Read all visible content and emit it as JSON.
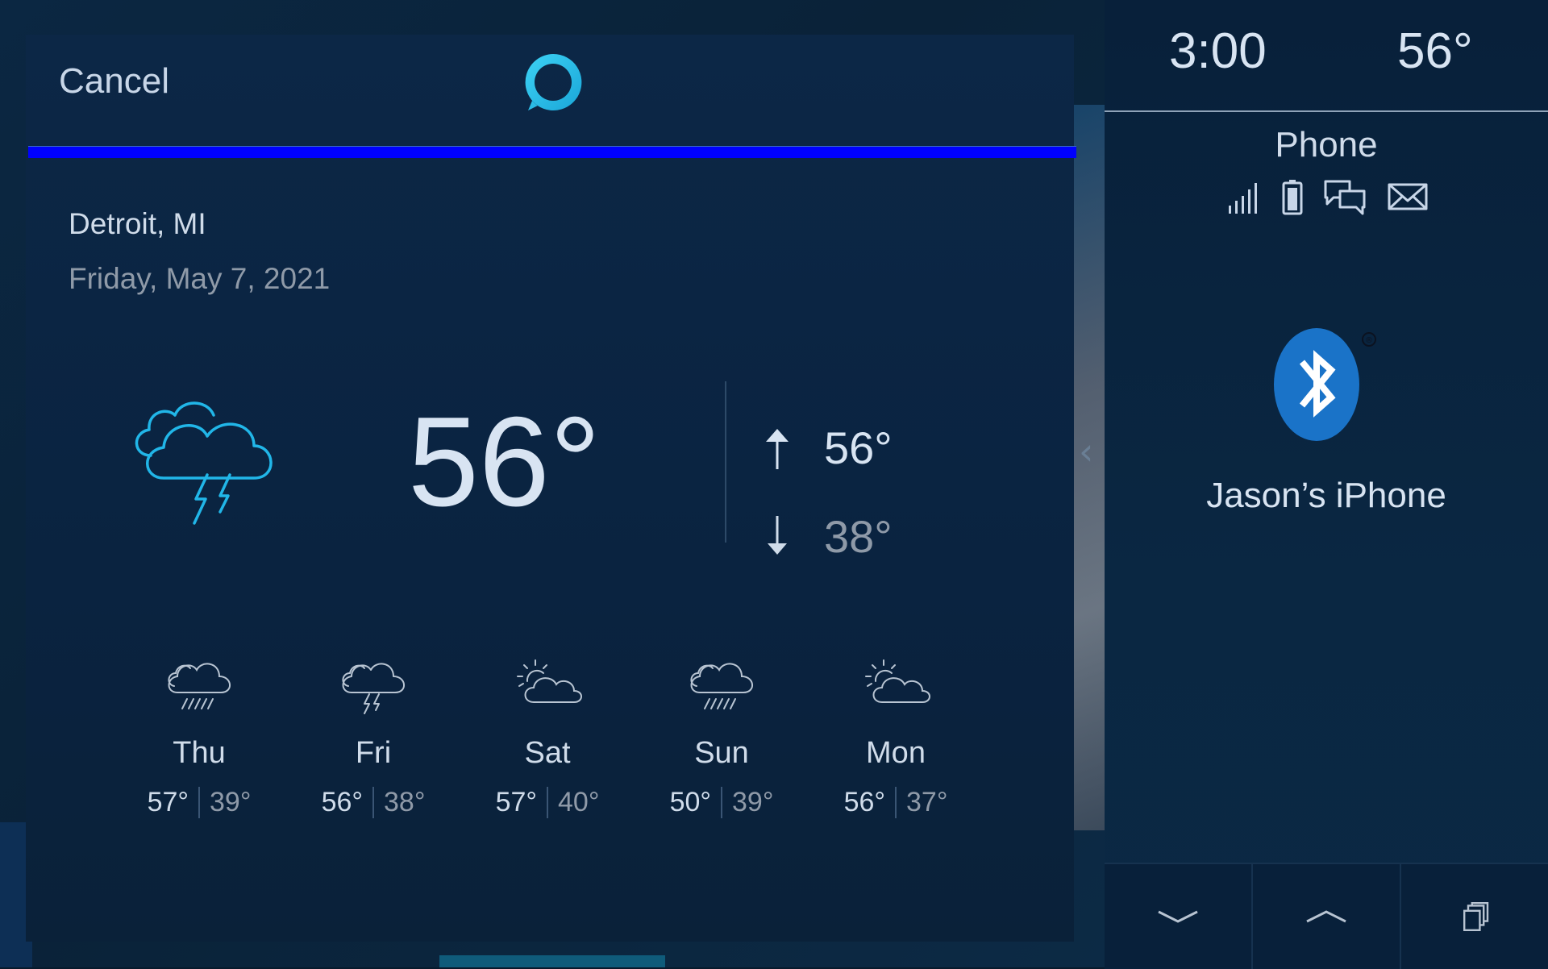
{
  "alexa_card": {
    "cancel_label": "Cancel",
    "progress_percent": 100,
    "location": "Detroit, MI",
    "date": "Friday, May 7, 2021",
    "current": {
      "temp": "56°",
      "condition_icon": "thunderstorm-icon",
      "high": "56°",
      "low": "38°"
    },
    "forecast": [
      {
        "day": "Thu",
        "high": "57°",
        "low": "39°",
        "icon": "rain-icon"
      },
      {
        "day": "Fri",
        "high": "56°",
        "low": "38°",
        "icon": "thunderstorm-icon"
      },
      {
        "day": "Sat",
        "high": "57°",
        "low": "40°",
        "icon": "partly-sunny-icon"
      },
      {
        "day": "Sun",
        "high": "50°",
        "low": "39°",
        "icon": "rain-icon"
      },
      {
        "day": "Mon",
        "high": "56°",
        "low": "37°",
        "icon": "partly-sunny-icon"
      }
    ]
  },
  "status_bar": {
    "time": "3:00",
    "outside_temp": "56°"
  },
  "phone_panel": {
    "title": "Phone",
    "icons": [
      "signal-icon",
      "battery-icon",
      "messages-icon",
      "email-icon"
    ],
    "device_name": "Jason’s iPhone",
    "bluetooth_registered_mark": "®"
  },
  "bottom_bar": {
    "buttons": [
      "chevron-down-icon",
      "chevron-up-icon",
      "app-switch-icon"
    ]
  },
  "colors": {
    "accent_cyan": "#21b6e8",
    "progress_blue": "#0000ff",
    "bluetooth_blue": "#1a73c8"
  }
}
